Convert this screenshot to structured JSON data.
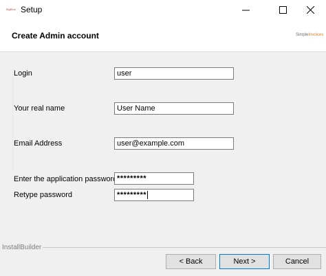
{
  "window": {
    "title": "Setup",
    "app_icon_text": "BigBlueBu",
    "controls": {
      "minimize": "minimize-icon",
      "maximize": "maximize-icon",
      "close": "close-icon"
    }
  },
  "header": {
    "title": "Create Admin account",
    "brand_prefix": "Simple",
    "brand_suffix": "Invoices"
  },
  "form": {
    "login": {
      "label": "Login",
      "value": "user"
    },
    "real_name": {
      "label": "Your real name",
      "value": "User Name"
    },
    "email": {
      "label": "Email Address",
      "value": "user@example.com"
    },
    "password": {
      "label": "Enter the application password",
      "value": "*********"
    },
    "retype": {
      "label": "Retype password",
      "value": "*********"
    }
  },
  "footer": {
    "installer_label": "InstallBuilder",
    "back_label": "< Back",
    "next_label": "Next >",
    "cancel_label": "Cancel"
  }
}
